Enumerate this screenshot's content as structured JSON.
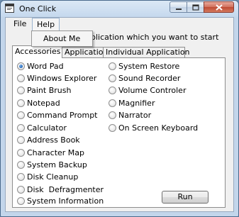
{
  "window": {
    "title": "One Click"
  },
  "menu": {
    "file": "File",
    "help": "Help",
    "help_items": [
      "About Me"
    ]
  },
  "instruction": "plication which you want to start",
  "tabs": [
    "Accessories",
    "Application",
    "Individual Application"
  ],
  "active_tab": 0,
  "options_left": [
    "Word Pad",
    "Windows Explorer",
    "Paint Brush",
    "Notepad",
    "Command Prompt",
    "Calculator",
    "Address Book",
    "Character Map",
    "System Backup",
    "Disk Cleanup",
    "Disk  Defragmenter",
    "System Information"
  ],
  "options_right": [
    "System Restore",
    "Sound Recorder",
    "Volume Controler",
    "Magnifier",
    "Narrator",
    "On Screen Keyboard"
  ],
  "selected_option": "Word Pad",
  "run_label": "Run",
  "colors": {
    "close_button": "#c9533d",
    "radio_selected": "#2a6fc2",
    "frame": "#c3d6eb"
  },
  "icons": {
    "app": "app-window-icon",
    "minimize": "minimize-icon",
    "maximize": "maximize-icon",
    "close": "close-icon"
  }
}
